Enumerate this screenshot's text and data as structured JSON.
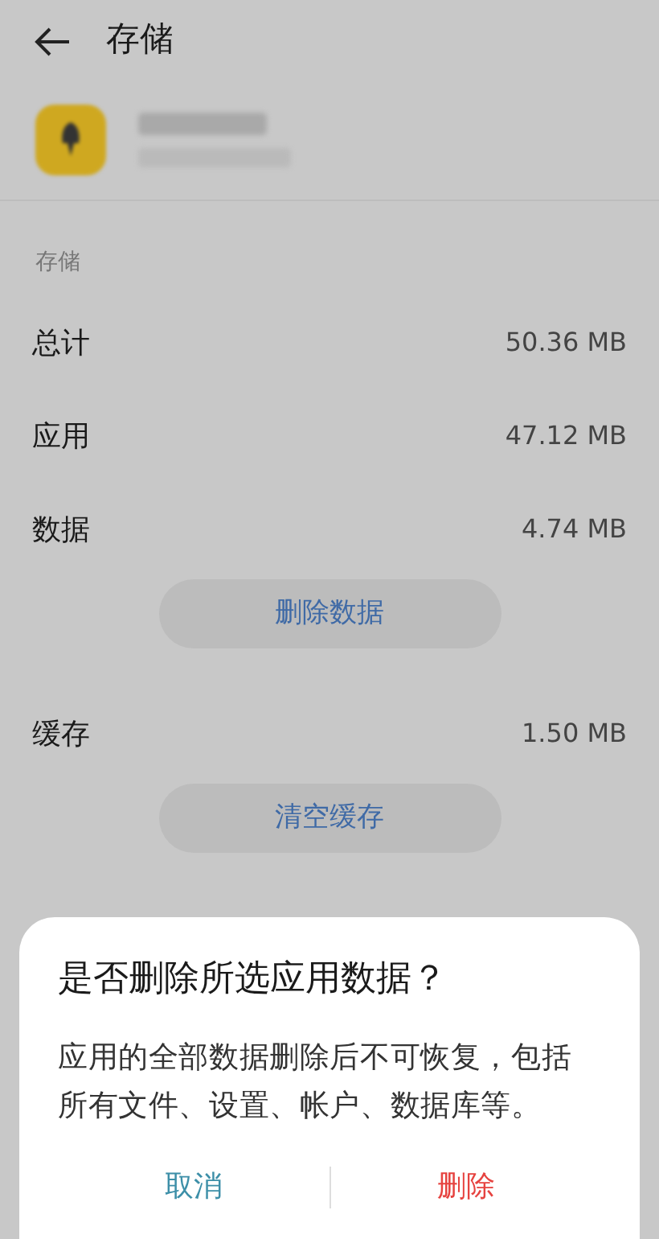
{
  "header": {
    "title": "存储"
  },
  "app": {
    "blurred": true
  },
  "section": {
    "title": "存储"
  },
  "rows": [
    {
      "label": "总计",
      "value": "50.36 MB"
    },
    {
      "label": "应用",
      "value": "47.12 MB"
    },
    {
      "label": "数据",
      "value": "4.74 MB",
      "action": "删除数据"
    },
    {
      "label": "缓存",
      "value": "1.50 MB",
      "action": "清空缓存"
    }
  ],
  "dialog": {
    "title": "是否删除所选应用数据？",
    "message": "应用的全部数据删除后不可恢复，包括所有文件、设置、帐户、数据库等。",
    "buttons": [
      {
        "label": "取消",
        "kind": "cancel"
      },
      {
        "label": "删除",
        "kind": "danger"
      }
    ]
  }
}
